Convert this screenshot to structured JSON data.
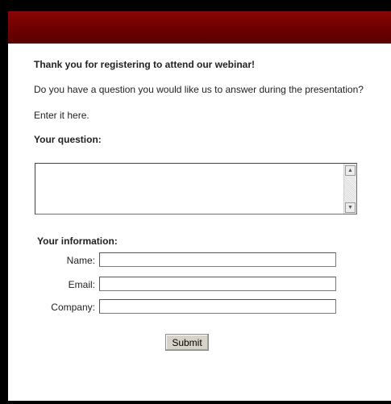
{
  "page": {
    "thank_you": "Thank you for registering to attend our webinar!",
    "question_prompt": "Do you have a question you would like us to answer during the presentation?",
    "enter_here": "Enter it here.",
    "your_question_heading": "Your question:",
    "your_information_heading": "Your information:"
  },
  "form": {
    "question_value": "",
    "name_label": "Name:",
    "name_value": "",
    "email_label": "Email:",
    "email_value": "",
    "company_label": "Company:",
    "company_value": "",
    "submit_label": "Submit"
  },
  "colors": {
    "header": "#6e0000",
    "heading_text": "#7d1111",
    "background": "#000000"
  }
}
